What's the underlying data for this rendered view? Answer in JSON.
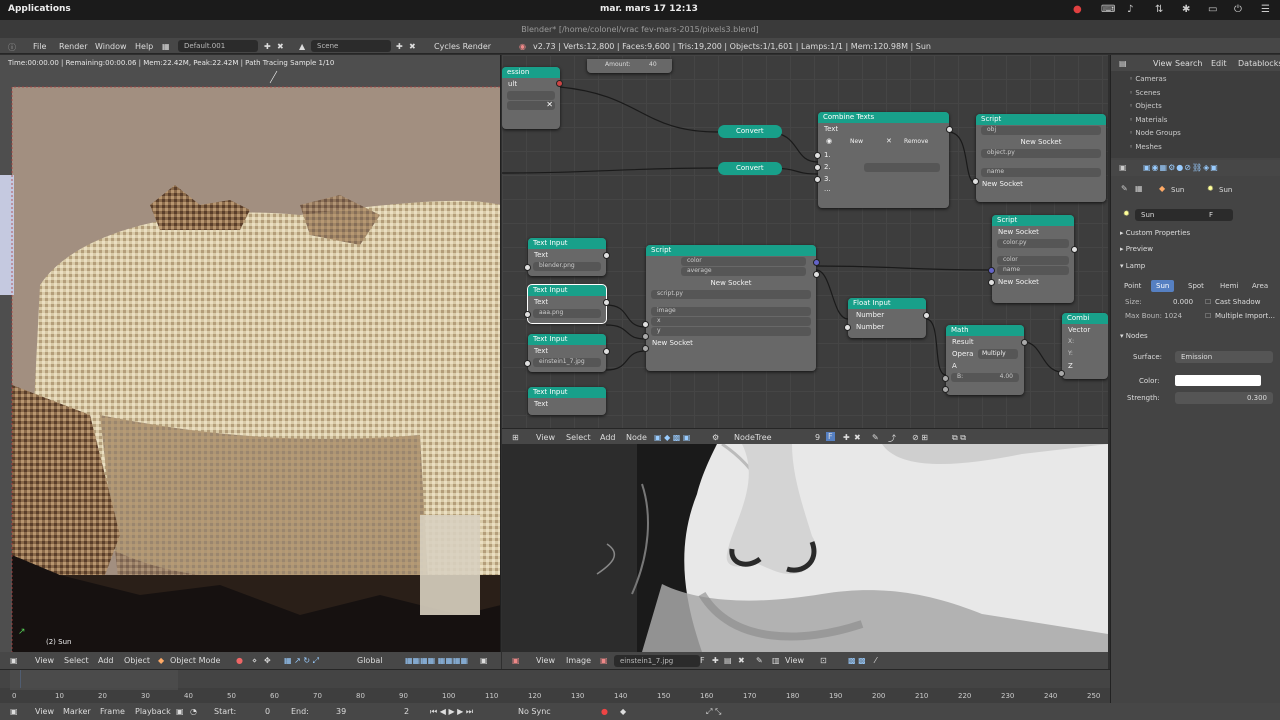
{
  "system": {
    "apps": "Applications",
    "clock": "mar. mars 17   12:13"
  },
  "window": {
    "title": "Blender* [/home/colonel/vrac fev-mars-2015/pixels3.blend]"
  },
  "info": {
    "file": "File",
    "render": "Render",
    "window": "Window",
    "help": "Help",
    "screen": "Default.001",
    "scene": "Scene",
    "engine": "Cycles Render",
    "stats": "v2.73 | Verts:12,800 | Faces:9,600 | Tris:19,200 | Objects:1/1,601 | Lamps:1/1 | Mem:120.98M | Sun"
  },
  "viewport": {
    "status": "Time:00:00.00 | Remaining:00:00.06 | Mem:22.42M, Peak:22.42M | Path Tracing Sample 1/10",
    "label": "(2) Sun"
  },
  "nodes": {
    "amount_label": "Amount:",
    "amount_value": "40",
    "ession": "ession",
    "ult": "ult",
    "convert1": "Convert",
    "convert2": "Convert",
    "combine_title": "Combine Texts",
    "combine_text": "Text",
    "combine_new": "New",
    "combine_remove": "Remove",
    "combine_r1": "1.",
    "combine_r2": "2.",
    "combine_r3": "3.",
    "combine_more": "...",
    "script1_title": "Script",
    "script1_obj": "obj",
    "script1_new": "New Socket",
    "script1_file": "object.py",
    "script1_name": "name",
    "script1_new2": "New Socket",
    "script2_title": "Script",
    "script2_new": "New Socket",
    "script2_file": "color.py",
    "script2_color": "color",
    "script2_name": "name",
    "script2_new2": "New Socket",
    "ti1_title": "Text Input",
    "ti1_text": "Text",
    "ti1_value": "blender.png",
    "ti2_title": "Text Input",
    "ti2_text": "Text",
    "ti2_value": "aaa.png",
    "ti3_title": "Text Input",
    "ti3_text": "Text",
    "ti3_value": "einstein1_7.jpg",
    "ti4_title": "Text Input",
    "ti4_text": "Text",
    "script3_title": "Script",
    "script3_color": "color",
    "script3_average": "average",
    "script3_new": "New Socket",
    "script3_file": "script.py",
    "script3_image": "image",
    "script3_x": "x",
    "script3_y": "y",
    "script3_new2": "New Socket",
    "float_title": "Float Input",
    "float_n1": "Number",
    "float_n2": "Number",
    "math_title": "Math",
    "math_result": "Result",
    "math_op_label": "Opera",
    "math_op": "Multiply",
    "math_a": "A",
    "math_b": "B:",
    "math_b_val": "4.00",
    "combine2_title": "Combi",
    "combine2_vector": "Vector",
    "combine2_x": "X:",
    "combine2_y": "Y:",
    "combine2_z": "Z"
  },
  "node_header": {
    "view": "View",
    "select": "Select",
    "add": "Add",
    "node": "Node",
    "tree": "NodeTree",
    "users": "9",
    "fake": "F"
  },
  "image_header": {
    "view": "View",
    "image": "Image",
    "file": "einstein1_7.jpg",
    "fake": "F",
    "view2": "View"
  },
  "v3d_header": {
    "view": "View",
    "select": "Select",
    "add": "Add",
    "object": "Object",
    "mode": "Object Mode",
    "orientation": "Global"
  },
  "timeline": {
    "ticks": [
      "0",
      "10",
      "20",
      "30",
      "40",
      "50",
      "60",
      "70",
      "80",
      "90",
      "100",
      "110",
      "120",
      "130",
      "140",
      "150",
      "160",
      "170",
      "180",
      "190",
      "200",
      "210",
      "220",
      "230",
      "240",
      "250"
    ]
  },
  "tl_header": {
    "view": "View",
    "marker": "Marker",
    "frame": "Frame",
    "playback": "Playback",
    "start_label": "Start:",
    "start": "0",
    "end_label": "End:",
    "end": "39",
    "current": "2",
    "sync": "No Sync"
  },
  "outliner": {
    "view": "View",
    "search": "Search",
    "edit": "Edit",
    "mode": "Datablocks",
    "items": [
      "Cameras",
      "Scenes",
      "Objects",
      "Materials",
      "Node Groups",
      "Meshes"
    ]
  },
  "props": {
    "ctx1": "Sun",
    "ctx2": "Sun",
    "lampname": "Sun",
    "fake": "F",
    "custom": "Custom Properties",
    "preview": "Preview",
    "lamp": "Lamp",
    "types": [
      "Point",
      "Sun",
      "Spot",
      "Hemi",
      "Area"
    ],
    "size_label": "Size:",
    "size_val": "0.000",
    "maxb_label": "Max Boun: 1024",
    "cast": "Cast Shadow",
    "mult": "Multiple Import...",
    "nodes": "Nodes",
    "surface_label": "Surface:",
    "surface_val": "Emission",
    "color_label": "Color:",
    "strength_label": "Strength:",
    "strength_val": "0.300"
  },
  "colors": {
    "node_header": "#18a08a",
    "accent": "#5680c2"
  }
}
